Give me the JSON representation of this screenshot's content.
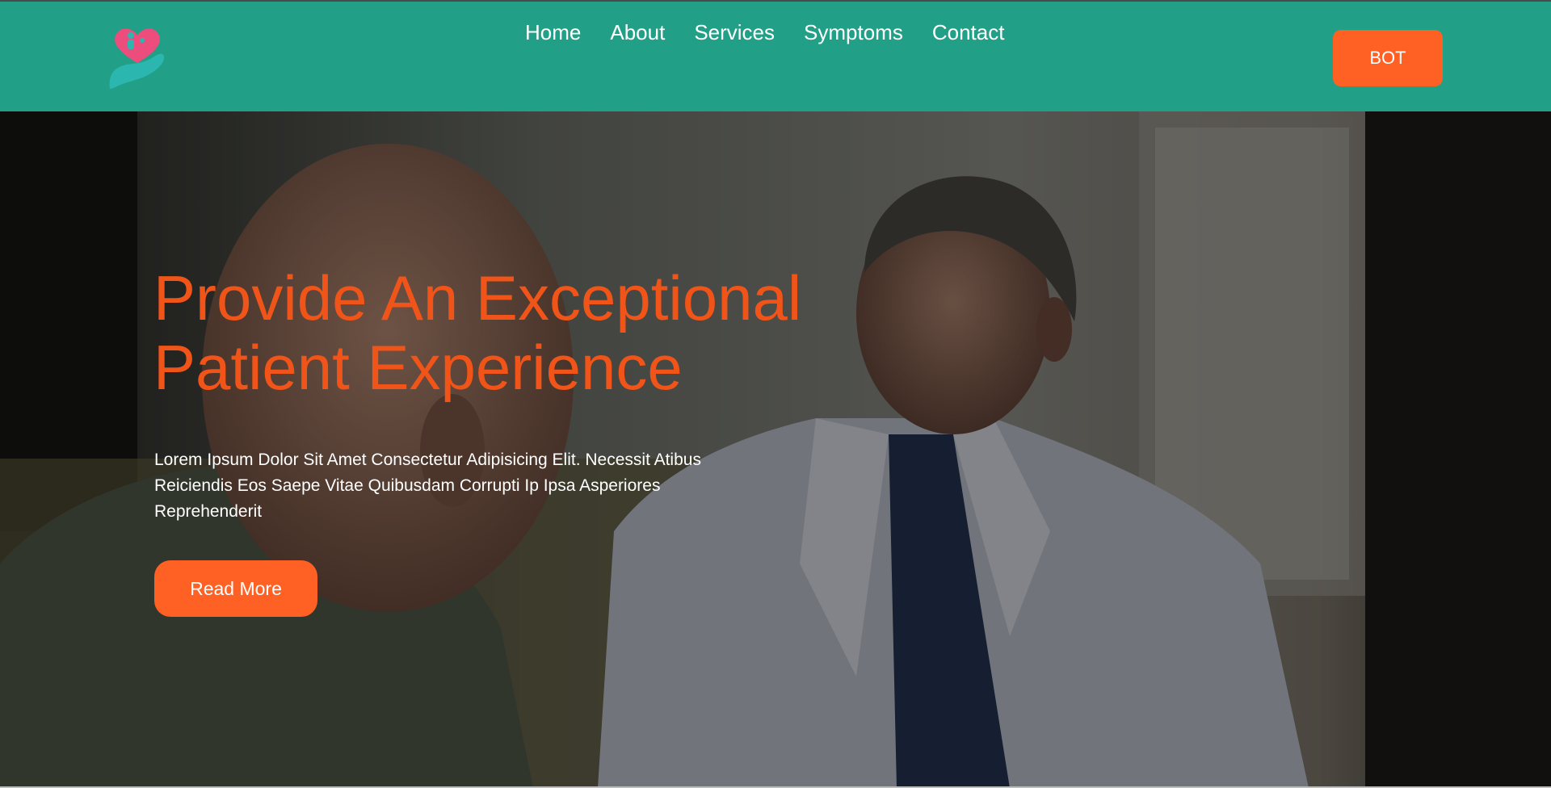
{
  "header": {
    "logo_icon": "heart-hand-icon",
    "nav": [
      {
        "label": "Home"
      },
      {
        "label": "About"
      },
      {
        "label": "Services"
      },
      {
        "label": "Symptoms"
      },
      {
        "label": "Contact"
      }
    ],
    "bot_label": "BOT"
  },
  "hero": {
    "title_line1": "Provide An Exceptional",
    "title_line2": "Patient Experience",
    "body": "Lorem Ipsum Dolor Sit Amet Consectetur Adipisicing Elit. Necessit Atibus Reiciendis Eos Saepe Vitae Quibusdam Corrupti Ip Ipsa Asperiores Reprehenderit",
    "read_more_label": "Read More",
    "background_image": "doctor-talking-with-patient-photo"
  },
  "colors": {
    "header_bg": "#21a087",
    "accent": "#ff6124",
    "title": "#f05418",
    "logo_heart": "#ec4d7c",
    "logo_hand": "#2bb7b0"
  }
}
